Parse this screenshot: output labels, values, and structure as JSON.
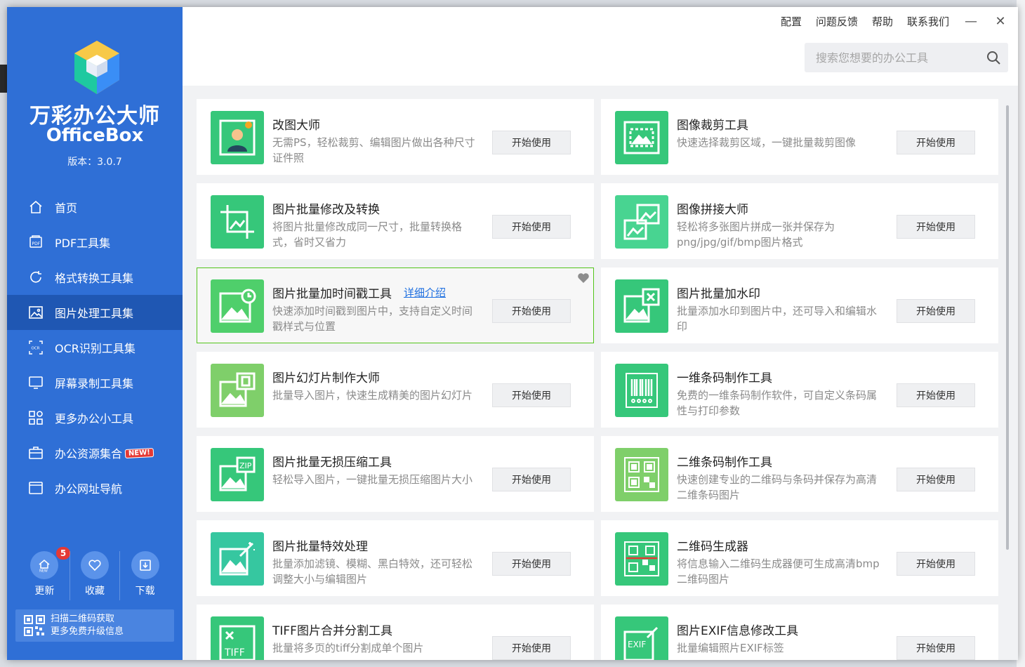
{
  "app": {
    "name": "万彩办公大师",
    "subtitle": "OfficeBox",
    "version": "版本：3.0.7"
  },
  "colors": {
    "sidebar": "#2f6fd6",
    "active_nav": "#1f57b3",
    "accent_green": "#52c41a"
  },
  "nav": [
    {
      "label": "首页",
      "icon": "home-icon"
    },
    {
      "label": "PDF工具集",
      "icon": "pdf-icon"
    },
    {
      "label": "格式转换工具集",
      "icon": "refresh-icon"
    },
    {
      "label": "图片处理工具集",
      "icon": "image-icon",
      "active": true
    },
    {
      "label": "OCR识别工具集",
      "icon": "ocr-icon"
    },
    {
      "label": "屏幕录制工具集",
      "icon": "monitor-icon"
    },
    {
      "label": "更多办公小工具",
      "icon": "grid-icon"
    },
    {
      "label": "办公资源集合",
      "icon": "briefcase-icon",
      "badge": "NEW!"
    },
    {
      "label": "办公网址导航",
      "icon": "browser-icon"
    }
  ],
  "bottom": {
    "update": {
      "label": "更新",
      "count": "5"
    },
    "favorite": {
      "label": "收藏"
    },
    "download": {
      "label": "下载"
    }
  },
  "qr_promo": {
    "line1": "扫描二维码获取",
    "line2": "更多免费升级信息"
  },
  "header": {
    "links": [
      "配置",
      "问题反馈",
      "帮助",
      "联系我们"
    ],
    "search_placeholder": "搜索您想要的办公工具"
  },
  "cards": [
    {
      "title": "改图大师",
      "desc": "无需PS，轻松裁剪、编辑图片做出各种尺寸证件照",
      "button": "开始使用"
    },
    {
      "title": "图像裁剪工具",
      "desc": "快速选择裁剪区域，一键批量裁剪图像",
      "button": "开始使用"
    },
    {
      "title": "图片批量修改及转换",
      "desc": "将图片批量修改成同一尺寸，批量转换格式，省时又省力",
      "button": "开始使用"
    },
    {
      "title": "图像拼接大师",
      "desc": "轻松将多张图片拼成一张并保存为png/jpg/gif/bmp图片格式",
      "button": "开始使用"
    },
    {
      "title": "图片批量加时间戳工具",
      "link": "详细介绍",
      "desc": "快速添加时间戳到图片中，支持自定义时间戳样式与位置",
      "button": "开始使用",
      "highlighted": true
    },
    {
      "title": "图片批量加水印",
      "desc": "批量添加水印到图片中，还可导入和编辑水印",
      "button": "开始使用"
    },
    {
      "title": "图片幻灯片制作大师",
      "desc": "批量导入图片，快速生成精美的图片幻灯片",
      "button": "开始使用"
    },
    {
      "title": "一维条码制作工具",
      "desc": "免费的一维条码制作软件，可自定义条码属性与打印参数",
      "button": "开始使用"
    },
    {
      "title": "图片批量无损压缩工具",
      "desc": "轻松导入图片，一键批量无损压缩图片大小",
      "button": "开始使用"
    },
    {
      "title": "二维条码制作工具",
      "desc": "快速创建专业的二维码与条码并保存为高清二维条码图片",
      "button": "开始使用"
    },
    {
      "title": "图片批量特效处理",
      "desc": "批量添加滤镜、模糊、黑白特效，还可轻松调整大小与编辑图片",
      "button": "开始使用"
    },
    {
      "title": "二维码生成器",
      "desc": "将信息输入二维码生成器便可生成高清bmp二维码图片",
      "button": "开始使用"
    },
    {
      "title": "TIFF图片合并分割工具",
      "desc": "批量将多页的tiff分割成单个图片",
      "button": "开始使用"
    },
    {
      "title": "图片EXIF信息修改工具",
      "desc": "批量编辑照片EXIF标签",
      "button": "开始使用"
    }
  ]
}
